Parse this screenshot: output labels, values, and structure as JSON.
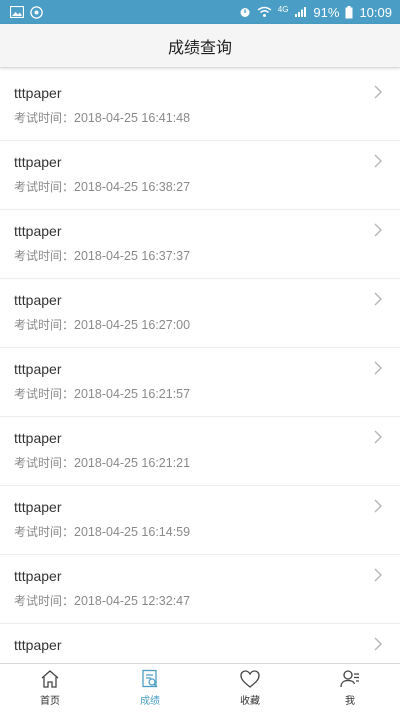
{
  "status_bar": {
    "battery": "91%",
    "time": "10:09",
    "network": "4G",
    "background_color": "#4a9dc4"
  },
  "header": {
    "title": "成绩查询"
  },
  "records": [
    {
      "title": "tttpaper",
      "time_label": "考试时间：",
      "time_value": "2018-04-25 16:41:48"
    },
    {
      "title": "tttpaper",
      "time_label": "考试时间：",
      "time_value": "2018-04-25 16:38:27"
    },
    {
      "title": "tttpaper",
      "time_label": "考试时间：",
      "time_value": "2018-04-25 16:37:37"
    },
    {
      "title": "tttpaper",
      "time_label": "考试时间：",
      "time_value": "2018-04-25 16:27:00"
    },
    {
      "title": "tttpaper",
      "time_label": "考试时间：",
      "time_value": "2018-04-25 16:21:57"
    },
    {
      "title": "tttpaper",
      "time_label": "考试时间：",
      "time_value": "2018-04-25 16:21:21"
    },
    {
      "title": "tttpaper",
      "time_label": "考试时间：",
      "time_value": "2018-04-25 16:14:59"
    },
    {
      "title": "tttpaper",
      "time_label": "考试时间：",
      "time_value": "2018-04-25 12:32:47"
    },
    {
      "title": "tttpaper",
      "time_label": "",
      "time_value": ""
    }
  ],
  "tabs": [
    {
      "label": "首页",
      "icon": "home-icon",
      "active": false
    },
    {
      "label": "成绩",
      "icon": "score-icon",
      "active": true
    },
    {
      "label": "收藏",
      "icon": "heart-icon",
      "active": false
    },
    {
      "label": "我",
      "icon": "user-icon",
      "active": false
    }
  ],
  "colors": {
    "accent": "#4a9dc4",
    "text_primary": "#333333",
    "text_secondary": "#8a8a8a"
  }
}
